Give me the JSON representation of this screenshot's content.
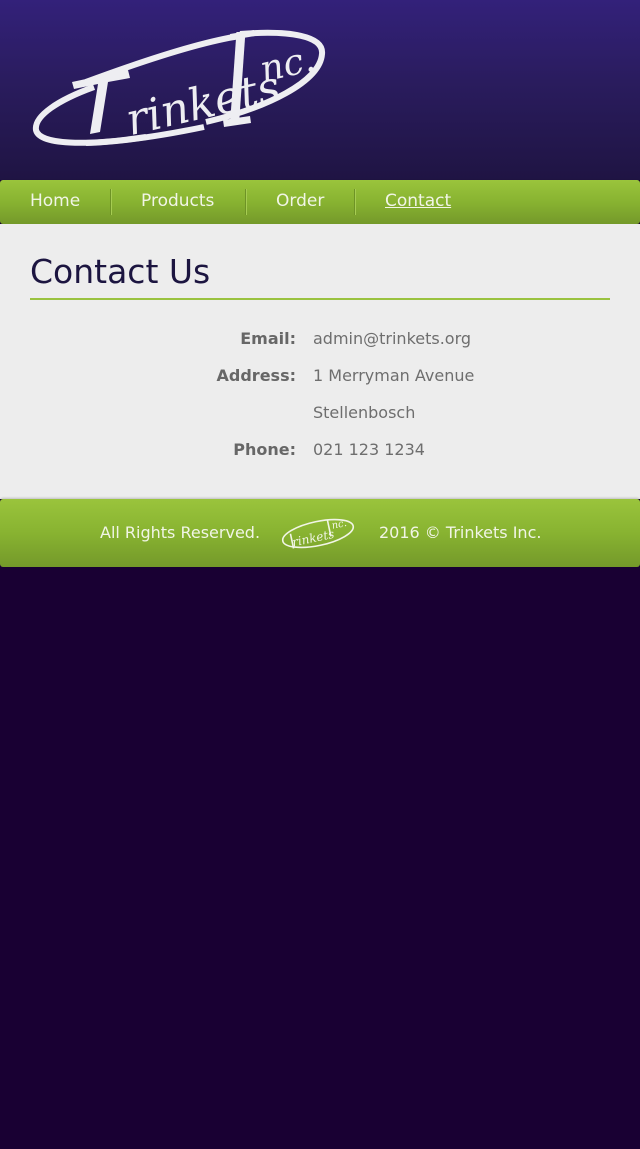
{
  "header": {
    "logo": {
      "name": "trinkets-inc-logo",
      "wordmark": "Trinkets Inc."
    }
  },
  "nav": {
    "items": [
      {
        "label": "Home",
        "active": false
      },
      {
        "label": "Products",
        "active": false
      },
      {
        "label": "Order",
        "active": false
      },
      {
        "label": "Contact",
        "active": true
      }
    ]
  },
  "main": {
    "title": "Contact Us",
    "contact": {
      "email_label": "Email:",
      "email_value": "admin@trinkets.org",
      "address_label": "Address:",
      "address_line1": "1 Merryman Avenue",
      "address_line2": "Stellenbosch",
      "phone_label": "Phone:",
      "phone_value": "021 123 1234"
    }
  },
  "footer": {
    "rights": "All Rights Reserved.",
    "copyright": "2016 © Trinkets Inc."
  },
  "colors": {
    "header_top": "#33217a",
    "header_bottom": "#1f1443",
    "nav_green": "#88b331",
    "page_background": "#190033",
    "content_background": "#ededed",
    "title_color": "#1c1540",
    "rule_green": "#9ac23f"
  }
}
